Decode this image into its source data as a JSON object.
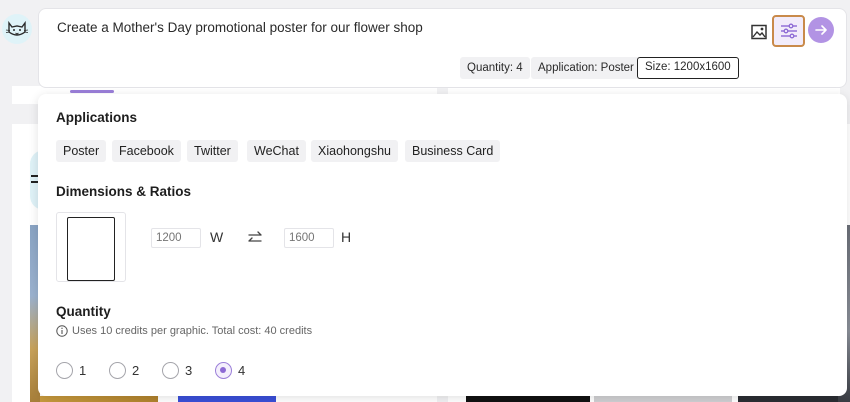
{
  "prompt": {
    "text": "Create a Mother's Day promotional poster for our flower shop",
    "chips": {
      "quantity": "Quantity: 4",
      "application": "Application: Poster",
      "size": "Size: 1200x1600"
    }
  },
  "icons": {
    "logo": "cat-logo-icon",
    "image": "image-icon",
    "settings": "sliders-icon",
    "send": "arrow-right-icon"
  },
  "settings": {
    "applications": {
      "title": "Applications",
      "options": [
        "Poster",
        "Facebook",
        "Twitter",
        "WeChat",
        "Xiaohongshu",
        "Business Card"
      ]
    },
    "dimensions": {
      "title": "Dimensions & Ratios",
      "width": "1200",
      "height": "1600",
      "width_label": "W",
      "height_label": "H"
    },
    "quantity": {
      "title": "Quantity",
      "info": "Uses 10 credits per graphic. Total cost: 40 credits",
      "options": [
        "1",
        "2",
        "3",
        "4"
      ],
      "selected": "4"
    }
  },
  "colors": {
    "accent": "#9b7fd9",
    "send_button": "#b293e4",
    "settings_highlight": "#c98a4a"
  }
}
